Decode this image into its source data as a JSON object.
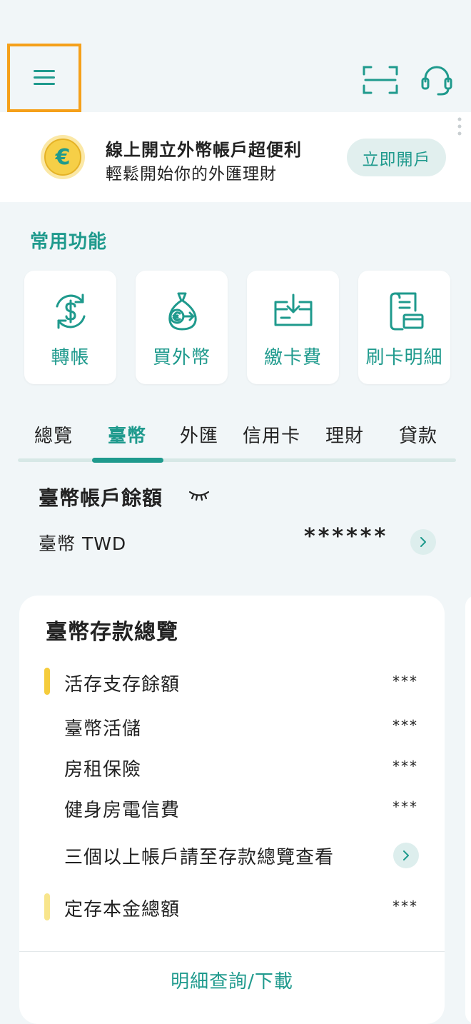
{
  "promo": {
    "title": "線上開立外幣帳戶超便利",
    "subtitle": "輕鬆開始你的外匯理財",
    "button": "立即開戶",
    "coin_symbol": "€"
  },
  "quick": {
    "title": "常用功能",
    "items": [
      {
        "label": "轉帳",
        "icon": "dollar-transfer-icon"
      },
      {
        "label": "買外幣",
        "icon": "currency-exchange-bag-icon"
      },
      {
        "label": "繳卡費",
        "icon": "card-payment-icon"
      },
      {
        "label": "刷卡明細",
        "icon": "receipt-card-icon"
      }
    ]
  },
  "tabs": [
    "總覽",
    "臺幣",
    "外匯",
    "信用卡",
    "理財",
    "貸款"
  ],
  "active_tab": "臺幣",
  "balance": {
    "title": "臺幣帳戶餘額",
    "currency": "臺幣 TWD",
    "amount": "******"
  },
  "deposit": {
    "title": "臺幣存款總覽",
    "rows": [
      {
        "label": "活存支存餘額",
        "value": "***"
      },
      {
        "label": "臺幣活儲",
        "value": "***"
      },
      {
        "label": "房租保險",
        "value": "***"
      },
      {
        "label": "健身房電信費",
        "value": "***"
      },
      {
        "label": "三個以上帳戶請至存款總覽查看"
      },
      {
        "label": "定存本金總額",
        "value": "***"
      }
    ],
    "link": "明細查詢/下載"
  },
  "colors": {
    "accent": "#1f9a8d",
    "highlight_border": "#f5a01a",
    "bar_yellow": "#f5cc3c",
    "bar_light_yellow": "#f8e58c"
  }
}
